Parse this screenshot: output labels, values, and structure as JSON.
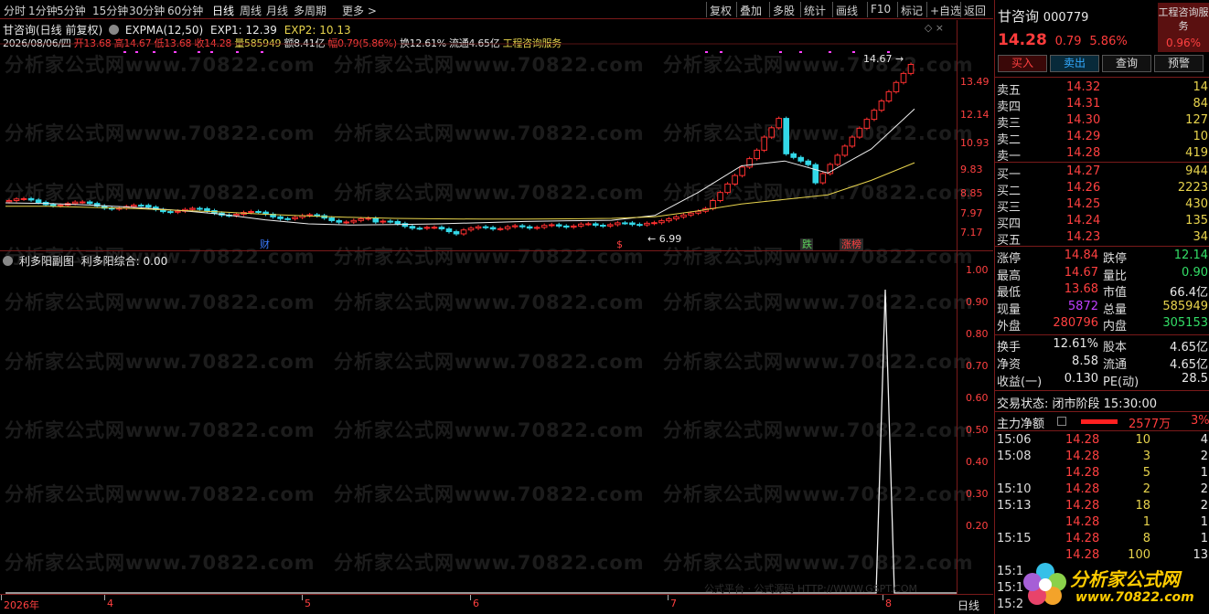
{
  "toolbar": {
    "periods": [
      "分时",
      "1分钟",
      "5分钟",
      "15分钟",
      "30分钟",
      "60分钟",
      "日线",
      "周线",
      "月线",
      "多周期",
      "更多 >"
    ],
    "actions": [
      "复权",
      "叠加",
      "多股",
      "统计",
      "画线",
      "F10",
      "标记",
      "+自选",
      "返回"
    ]
  },
  "main_chart": {
    "title": "甘咨询(日线 前复权)",
    "indicator": "EXPMA(12,50)",
    "exp1": "EXP1: 12.39",
    "exp2": "EXP2: 10.13",
    "info_date": "2026/08/06/四",
    "info_open": "开13.68",
    "info_high": "高14.67",
    "info_low": "低13.68",
    "info_close": "收14.28",
    "info_vol": "量585949",
    "info_amt": "额8.41亿",
    "info_range": "幅0.79(5.86%)",
    "info_turn": "换12.61%",
    "info_float": "流通4.65亿",
    "info_tag": "工程咨询服务",
    "price_axis": [
      "13.49",
      "12.14",
      "10.93",
      "9.83",
      "8.85",
      "7.97",
      "7.17"
    ],
    "high_marker": "14.67",
    "low_marker": "6.99",
    "markers": [
      "财",
      "$",
      "跌",
      "涨榜"
    ]
  },
  "chart_data": [
    {
      "type": "line",
      "title": "",
      "series": [
        {
          "name": "EXP1",
          "values": [
            8.45,
            8.42,
            8.35,
            8.25,
            8.12,
            7.95,
            7.72,
            7.55,
            7.5,
            7.52,
            7.55,
            7.6,
            7.65,
            7.68,
            7.7,
            7.9,
            8.9,
            10.0,
            10.2,
            9.7,
            10.7,
            12.39
          ]
        },
        {
          "name": "EXP2",
          "values": [
            8.3,
            8.3,
            8.25,
            8.2,
            8.12,
            8.05,
            7.95,
            7.88,
            7.82,
            7.78,
            7.76,
            7.75,
            7.75,
            7.76,
            7.78,
            7.85,
            8.1,
            8.4,
            8.6,
            8.8,
            9.4,
            10.13
          ]
        }
      ],
      "ylim": [
        6.8,
        15.0
      ]
    },
    {
      "type": "line",
      "title": "",
      "series": [
        {
          "name": "利多阳综合",
          "values": [
            0,
            0,
            0,
            0,
            0,
            0,
            0,
            0,
            0,
            0,
            0,
            0,
            0,
            0,
            0,
            0,
            0,
            0,
            0,
            0,
            1.0,
            0
          ]
        }
      ],
      "ylim": [
        0,
        1.05
      ]
    }
  ],
  "sub_chart": {
    "title": "利多阳副图",
    "value": "利多阳综合: 0.00",
    "axis": [
      "1.00",
      "0.90",
      "0.80",
      "0.70",
      "0.60",
      "0.50",
      "0.40",
      "0.30",
      "0.20"
    ],
    "formula_note": "公式平台 · 公式源码 HTTP://WWW.GSPT.COM"
  },
  "time_axis": [
    "2026年",
    "4",
    "5",
    "6",
    "7",
    "8"
  ],
  "time_axis_period": "日线",
  "quote": {
    "name": "甘咨询",
    "code": "000779",
    "industry": "工程咨询服务",
    "price": "14.28",
    "change": "0.79",
    "change_pct": "5.86%",
    "industry_pct": "0.96%",
    "buttons": [
      "买入",
      "卖出",
      "查询",
      "预警"
    ],
    "asks": [
      {
        "label": "卖五",
        "price": "14.32",
        "vol": "14"
      },
      {
        "label": "卖四",
        "price": "14.31",
        "vol": "84"
      },
      {
        "label": "卖三",
        "price": "14.30",
        "vol": "127"
      },
      {
        "label": "卖二",
        "price": "14.29",
        "vol": "10"
      },
      {
        "label": "卖一",
        "price": "14.28",
        "vol": "419"
      }
    ],
    "bids": [
      {
        "label": "买一",
        "price": "14.27",
        "vol": "944"
      },
      {
        "label": "买二",
        "price": "14.26",
        "vol": "2223"
      },
      {
        "label": "买三",
        "price": "14.25",
        "vol": "430"
      },
      {
        "label": "买四",
        "price": "14.24",
        "vol": "135"
      },
      {
        "label": "买五",
        "price": "14.23",
        "vol": "34"
      }
    ],
    "stats": [
      {
        "l1": "涨停",
        "v1": "14.84",
        "l2": "跌停",
        "v2": "12.14"
      },
      {
        "l1": "最高",
        "v1": "14.67",
        "l2": "量比",
        "v2": "0.90"
      },
      {
        "l1": "最低",
        "v1": "13.68",
        "l2": "市值",
        "v2": "66.4亿"
      },
      {
        "l1": "现量",
        "v1": "5872",
        "l2": "总量",
        "v2": "585949"
      },
      {
        "l1": "外盘",
        "v1": "280796",
        "l2": "内盘",
        "v2": "305153"
      }
    ],
    "stats2": [
      {
        "l1": "换手",
        "v1": "12.61%",
        "l2": "股本",
        "v2": "4.65亿"
      },
      {
        "l1": "净资",
        "v1": "8.58",
        "l2": "流通",
        "v2": "4.65亿"
      },
      {
        "l1": "收益(一)",
        "v1": "0.130",
        "l2": "PE(动)",
        "v2": "28.5"
      }
    ],
    "trade_status": "交易状态: 闭市阶段 15:30:00",
    "main_flow_label": "主力净额",
    "main_flow_value": "2577万",
    "main_flow_pct": "3%",
    "ticks": [
      {
        "time": "15:06",
        "price": "14.28",
        "vol": "10",
        "n": "4"
      },
      {
        "time": "15:08",
        "price": "14.28",
        "vol": "3",
        "n": "2"
      },
      {
        "time": "",
        "price": "14.28",
        "vol": "5",
        "n": "1"
      },
      {
        "time": "15:10",
        "price": "14.28",
        "vol": "2",
        "n": "2"
      },
      {
        "time": "15:13",
        "price": "14.28",
        "vol": "18",
        "n": "2"
      },
      {
        "time": "",
        "price": "14.28",
        "vol": "1",
        "n": "1"
      },
      {
        "time": "15:15",
        "price": "14.28",
        "vol": "8",
        "n": "1"
      },
      {
        "time": "",
        "price": "14.28",
        "vol": "100",
        "n": "13"
      },
      {
        "time": "15:1",
        "price": "",
        "vol": "",
        "n": ""
      },
      {
        "time": "15:1",
        "price": "",
        "vol": "",
        "n": ""
      },
      {
        "time": "15:2",
        "price": "",
        "vol": "",
        "n": ""
      }
    ]
  },
  "watermark": "分析家公式网www.70822.com",
  "logo": {
    "text": "分析家公式网",
    "url": "www.70822.com"
  }
}
